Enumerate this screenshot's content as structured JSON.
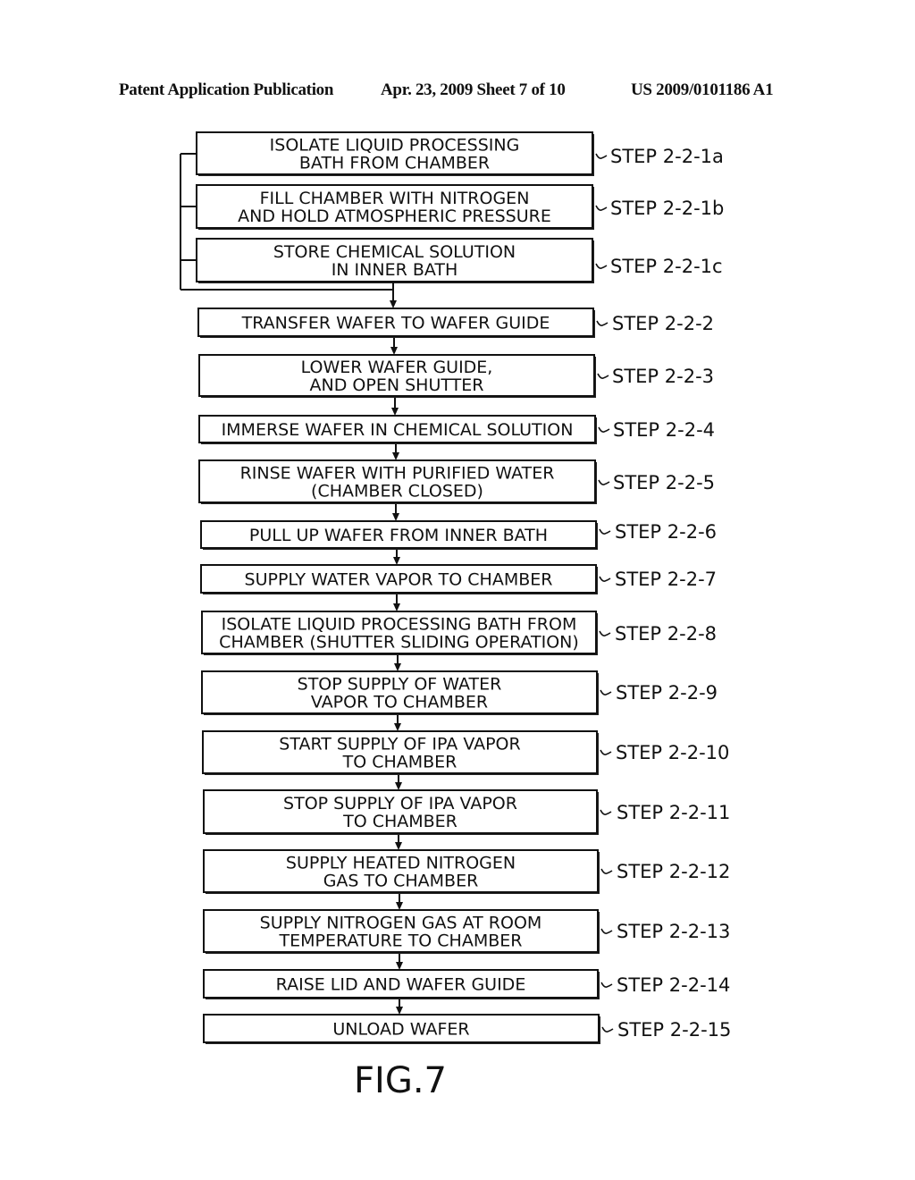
{
  "header": {
    "left": "Patent Application Publication",
    "middle": "Apr. 23, 2009  Sheet 7 of 10",
    "right": "US 2009/0101186 A1"
  },
  "figure_label": "FIG.7",
  "parallel_steps": [
    {
      "lines": [
        "ISOLATE LIQUID PROCESSING",
        "BATH FROM CHAMBER"
      ],
      "step": "STEP 2-2-1a"
    },
    {
      "lines": [
        "FILL CHAMBER WITH NITROGEN",
        "AND HOLD ATMOSPHERIC PRESSURE"
      ],
      "step": "STEP 2-2-1b"
    },
    {
      "lines": [
        "STORE CHEMICAL SOLUTION",
        "IN INNER BATH"
      ],
      "step": "STEP 2-2-1c"
    }
  ],
  "steps": [
    {
      "lines": [
        "TRANSFER WAFER TO WAFER GUIDE"
      ],
      "step": "STEP 2-2-2"
    },
    {
      "lines": [
        "LOWER WAFER GUIDE,",
        "AND OPEN SHUTTER"
      ],
      "step": "STEP 2-2-3"
    },
    {
      "lines": [
        "IMMERSE WAFER IN CHEMICAL SOLUTION"
      ],
      "step": "STEP 2-2-4"
    },
    {
      "lines": [
        "RINSE WAFER WITH PURIFIED WATER",
        "(CHAMBER CLOSED)"
      ],
      "step": "STEP 2-2-5"
    },
    {
      "lines": [
        "PULL UP WAFER FROM INNER BATH"
      ],
      "step": "STEP 2-2-6"
    },
    {
      "lines": [
        "SUPPLY WATER VAPOR TO CHAMBER"
      ],
      "step": "STEP 2-2-7"
    },
    {
      "lines": [
        "ISOLATE LIQUID PROCESSING BATH FROM",
        "CHAMBER (SHUTTER SLIDING OPERATION)"
      ],
      "step": "STEP 2-2-8"
    },
    {
      "lines": [
        "STOP SUPPLY OF WATER",
        "VAPOR TO CHAMBER"
      ],
      "step": "STEP 2-2-9"
    },
    {
      "lines": [
        "START SUPPLY OF IPA VAPOR",
        "TO CHAMBER"
      ],
      "step": "STEP 2-2-10"
    },
    {
      "lines": [
        "STOP SUPPLY OF IPA VAPOR",
        "TO CHAMBER"
      ],
      "step": "STEP 2-2-11"
    },
    {
      "lines": [
        "SUPPLY HEATED NITROGEN",
        "GAS TO CHAMBER"
      ],
      "step": "STEP 2-2-12"
    },
    {
      "lines": [
        "SUPPLY NITROGEN GAS AT ROOM",
        "TEMPERATURE TO CHAMBER"
      ],
      "step": "STEP 2-2-13"
    },
    {
      "lines": [
        "RAISE LID AND WAFER GUIDE"
      ],
      "step": "STEP 2-2-14"
    },
    {
      "lines": [
        "UNLOAD WAFER"
      ],
      "step": "STEP 2-2-15"
    }
  ]
}
